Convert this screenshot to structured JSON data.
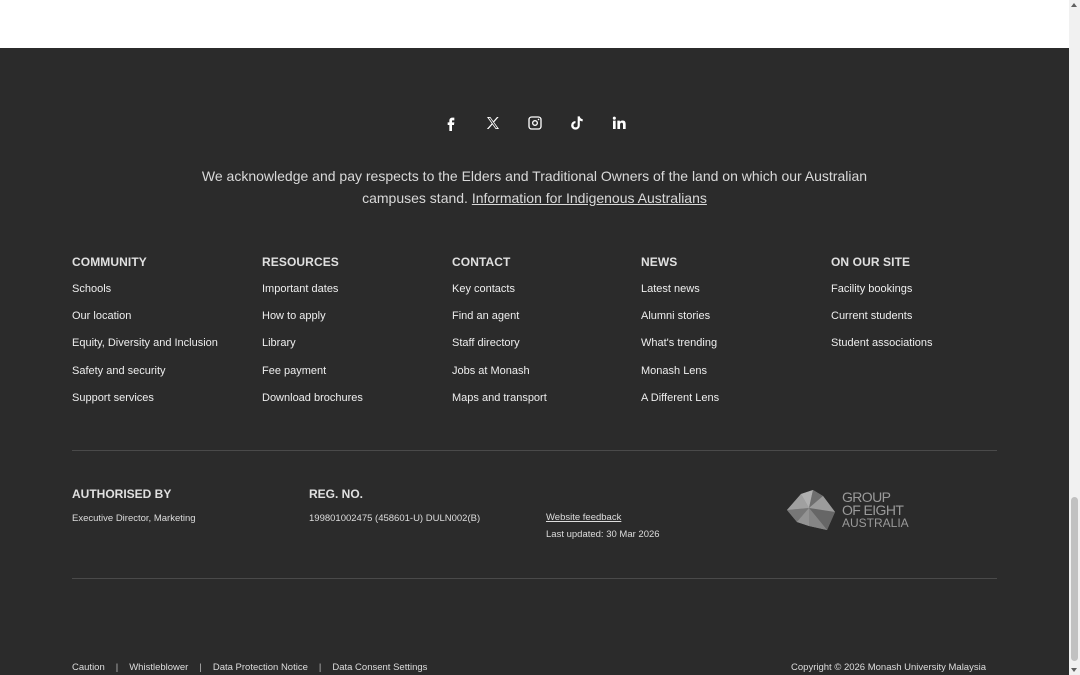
{
  "social": [
    {
      "name": "facebook"
    },
    {
      "name": "x"
    },
    {
      "name": "instagram"
    },
    {
      "name": "tiktok"
    },
    {
      "name": "linkedin"
    }
  ],
  "acknowledgement": {
    "text": "We acknowledge and pay respects to the Elders and Traditional Owners of the land on which our Australian campuses stand.",
    "link": "Information for Indigenous Australians"
  },
  "columns": [
    {
      "title": "COMMUNITY",
      "items": [
        "Schools",
        "Our location",
        "Equity, Diversity and Inclusion",
        "Safety and security",
        "Support services"
      ]
    },
    {
      "title": "RESOURCES",
      "items": [
        "Important dates",
        "How to apply",
        "Library",
        "Fee payment",
        "Download brochures"
      ]
    },
    {
      "title": "CONTACT",
      "items": [
        "Key contacts",
        "Find an agent",
        "Staff directory",
        "Jobs at Monash",
        "Maps and transport"
      ]
    },
    {
      "title": "NEWS",
      "items": [
        "Latest news",
        "Alumni stories",
        "What's trending",
        "Monash Lens",
        "A Different Lens"
      ]
    },
    {
      "title": "ON OUR SITE",
      "items": [
        "Facility bookings",
        "Current students",
        "Student associations"
      ]
    }
  ],
  "meta": {
    "authorised_by_label": "AUTHORISED BY",
    "authorised_by_value": "Executive Director, Marketing",
    "reg_no_label": "REG. NO.",
    "reg_no_value": "199801002475 (458601-U) DULN002(B)",
    "feedback_link": "Website feedback",
    "last_updated": "Last updated: 30 Mar 2026"
  },
  "logo": {
    "line1": "GROUP",
    "line2": "OF EIGHT",
    "line3": "AUSTRALIA"
  },
  "bottom_links": [
    "Caution",
    "Whistleblower",
    "Data Protection Notice",
    "Data Consent Settings"
  ],
  "separator": "|",
  "copyright": "Copyright © 2026 Monash University Malaysia"
}
